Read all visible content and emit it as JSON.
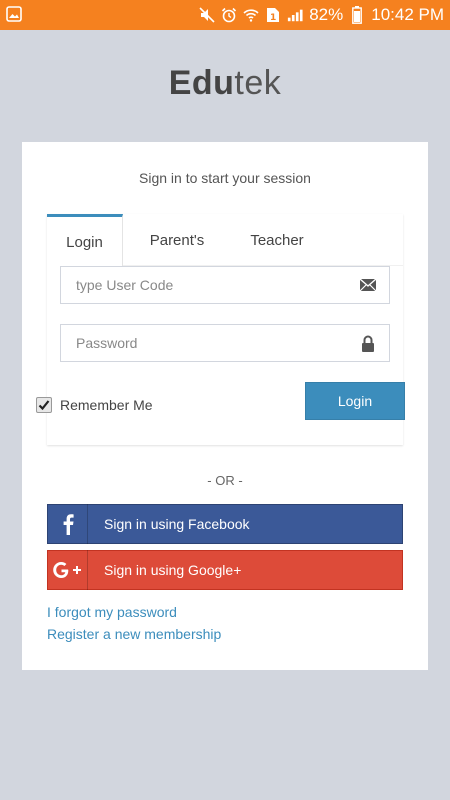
{
  "status_bar": {
    "battery": "82%",
    "time": "10:42 PM",
    "icons": [
      "image-icon",
      "mute-icon",
      "alarm-icon",
      "wifi-icon",
      "sim-icon",
      "signal-icon",
      "battery-icon"
    ]
  },
  "logo": {
    "bold": "Edu",
    "light": "tek"
  },
  "login_box": {
    "message": "Sign in to start your session",
    "tabs": [
      {
        "label": "Login",
        "active": true
      },
      {
        "label": "Parent's",
        "active": false
      },
      {
        "label": "Teacher",
        "active": false
      }
    ],
    "user_code": {
      "placeholder": "type User Code",
      "value": ""
    },
    "password": {
      "placeholder": "Password",
      "value": ""
    },
    "remember_me": {
      "label": "Remember Me",
      "checked": true
    },
    "login_button": "Login"
  },
  "or_divider": "- OR -",
  "social": {
    "facebook": "Sign in using Facebook",
    "google": "Sign in using Google+"
  },
  "links": {
    "forgot": "I forgot my password",
    "register": "Register a new membership"
  },
  "colors": {
    "status_bar": "#f5811f",
    "accent": "#3c8dbc",
    "facebook": "#3b5998",
    "google": "#dd4b39",
    "background": "#d2d6de"
  }
}
